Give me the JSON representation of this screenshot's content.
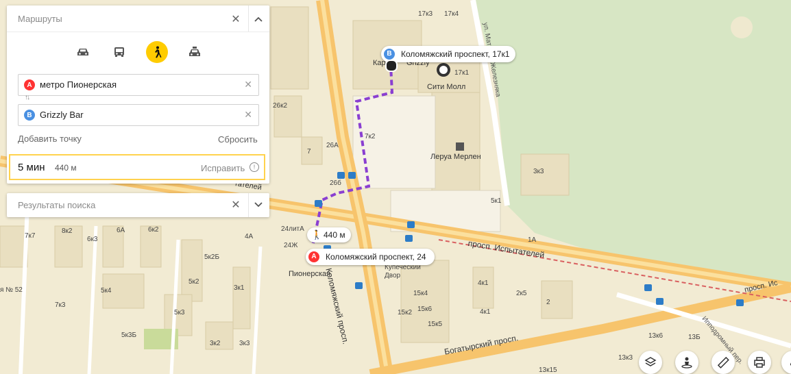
{
  "routes": {
    "title": "Маршруты",
    "modes": [
      {
        "name": "car",
        "icon": "car-icon",
        "active": false
      },
      {
        "name": "bus",
        "icon": "bus-icon",
        "active": false
      },
      {
        "name": "walk",
        "icon": "pedestrian-icon",
        "active": true
      },
      {
        "name": "taxi",
        "icon": "taxi-icon",
        "active": false
      }
    ],
    "point_a": {
      "marker": "A",
      "value": "метро Пионерская"
    },
    "point_b": {
      "marker": "B",
      "value": "Grizzly Bar"
    },
    "add_point": "Добавить точку",
    "reset": "Сбросить",
    "summary": {
      "time": "5 мин",
      "distance": "440 м",
      "fix": "Исправить"
    }
  },
  "search": {
    "title": "Результаты поиска"
  },
  "map": {
    "start_label": "Коломяжский проспект, 24",
    "end_label": "Коломяжский проспект, 17к1",
    "walk_distance": "440 м",
    "places": [
      "Сити Молл",
      "Леруа Мерлен",
      "Купеческий Двор",
      "Пионерская",
      "Кар",
      "Grizzly"
    ],
    "streets": [
      "Коломяжский просп.",
      "просп. Испытателей",
      "Богатырский просп.",
      "ул. Матроса Железняка",
      "Ипподромный пер.",
      "тателей",
      "просп. Ис"
    ],
    "house_numbers": [
      "17к3",
      "17к4",
      "17к1",
      "7к2",
      "5к1",
      "3к3",
      "1А",
      "26к2",
      "26А",
      "26б",
      "7",
      "24литА",
      "24Ж",
      "6к2",
      "6А",
      "6к3",
      "8к2",
      "7к7",
      "4А",
      "5к2Б",
      "5к2",
      "5к4",
      "5к3",
      "7к3",
      "5к3Б",
      "3к2",
      "3к3",
      "3к1",
      "4к1",
      "2к5",
      "2",
      "15к4",
      "15к6",
      "15к2",
      "15к5",
      "13к6",
      "13Б",
      "13к3",
      "13к15",
      "4к1",
      "я № 52"
    ]
  },
  "colors": {
    "route": "#8a3fd1",
    "accent": "#ffcc00",
    "marker_a": "#f33",
    "marker_b": "#4a90e2",
    "avenue": "#f7c46c"
  }
}
